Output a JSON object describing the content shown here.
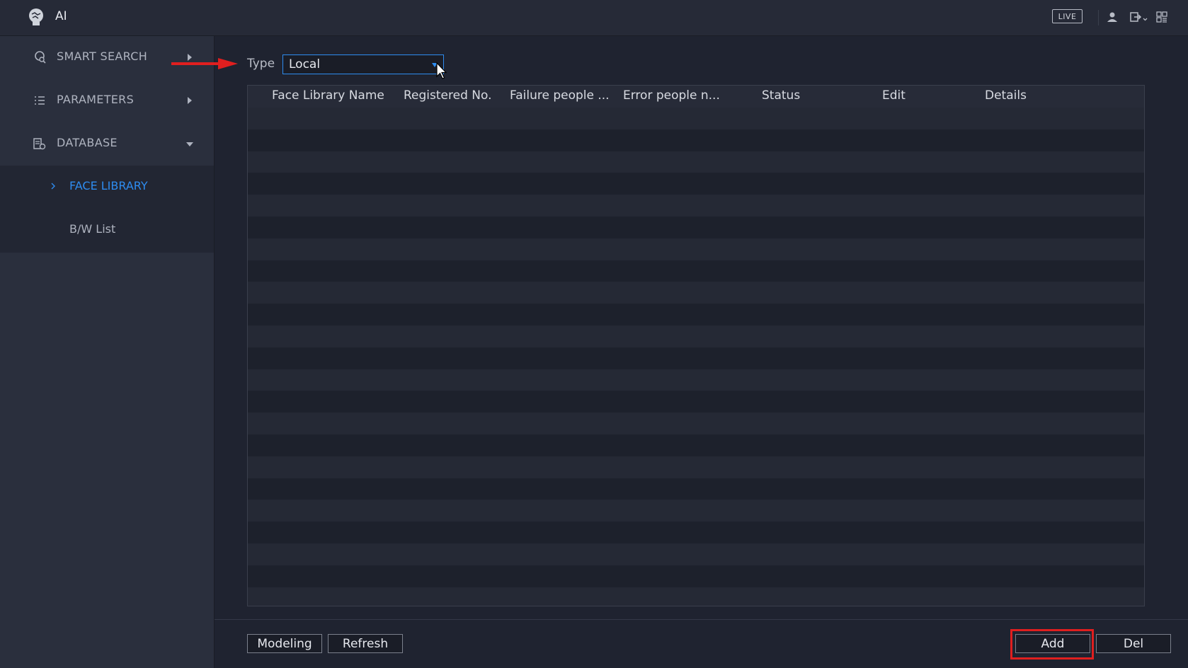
{
  "app": {
    "title": "AI",
    "live_label": "LIVE"
  },
  "sidebar": {
    "items": [
      {
        "label": "SMART SEARCH",
        "icon": "smart-search-icon"
      },
      {
        "label": "PARAMETERS",
        "icon": "list-icon"
      },
      {
        "label": "DATABASE",
        "icon": "database-icon"
      }
    ],
    "subitems": [
      {
        "label": "FACE LIBRARY",
        "active": true
      },
      {
        "label": "B/W List",
        "active": false
      }
    ]
  },
  "filter": {
    "type_label": "Type",
    "type_value": "Local"
  },
  "table": {
    "columns": [
      "Face Library Name",
      "Registered No.",
      "Failure people ...",
      "Error people n...",
      "Status",
      "Edit",
      "Details"
    ],
    "rows": []
  },
  "footer": {
    "modeling_label": "Modeling",
    "refresh_label": "Refresh",
    "add_label": "Add",
    "del_label": "Del"
  },
  "colors": {
    "accent": "#2e8cf0",
    "highlight": "#e01f1f",
    "background": "#1f2330",
    "sidebar": "#2a2f3d"
  }
}
